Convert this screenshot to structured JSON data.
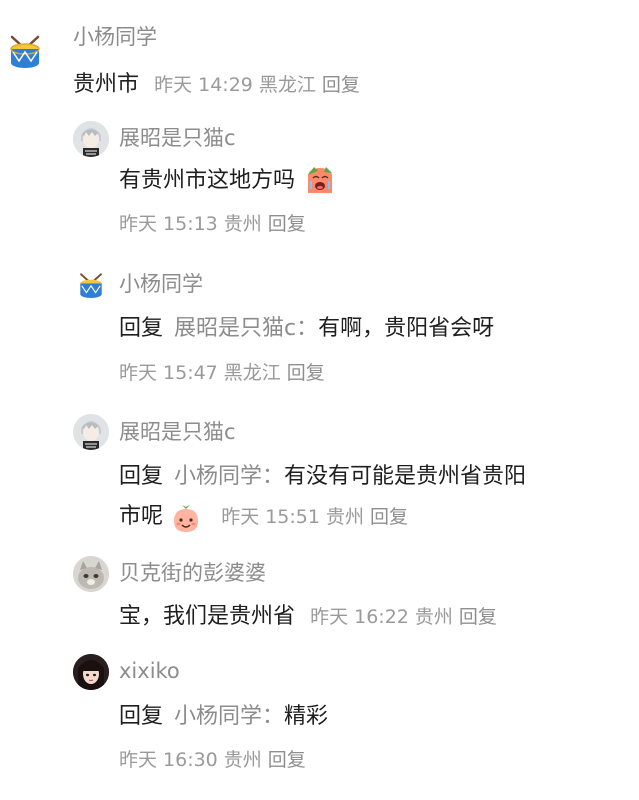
{
  "root_comment": {
    "author": "小杨同学",
    "content": "贵州市",
    "date": "昨天",
    "time": "14:29",
    "location": "黑龙江",
    "reply_label": "回复"
  },
  "replies": [
    {
      "author": "展昭是只猫c",
      "content": "有贵州市这地方吗",
      "emoji": "crying-face-emoji",
      "date": "昨天",
      "time": "15:13",
      "location": "贵州",
      "reply_label": "回复"
    },
    {
      "author": "小杨同学",
      "prefix": "回复",
      "target": "展昭是只猫c：",
      "content": "有啊，贵阳省会呀",
      "date": "昨天",
      "time": "15:47",
      "location": "黑龙江",
      "reply_label": "回复"
    },
    {
      "author": "展昭是只猫c",
      "prefix": "回复",
      "target": "小杨同学：",
      "content_line1": "有没有可能是贵州省贵阳",
      "content_line2": "市呢",
      "emoji": "smiling-peach-emoji",
      "date": "昨天",
      "time": "15:51",
      "location": "贵州",
      "reply_label": "回复"
    },
    {
      "author": "贝克街的彭婆婆",
      "content": "宝，我们是贵州省",
      "date": "昨天",
      "time": "16:22",
      "location": "贵州",
      "reply_label": "回复"
    },
    {
      "author": "xixiko",
      "prefix": "回复",
      "target": "小杨同学：",
      "content": "精彩",
      "date": "昨天",
      "time": "16:30",
      "location": "贵州",
      "reply_label": "回复"
    }
  ],
  "colors": {
    "name": "#8c8c8c",
    "content": "#1f1f1f",
    "meta": "#9a9a9a",
    "background": "#ffffff"
  },
  "icons": {
    "drum_avatar": "drum-icon",
    "cat_avatar": "cat-avatar-icon",
    "character_avatar": "anime-character-avatar-icon"
  }
}
